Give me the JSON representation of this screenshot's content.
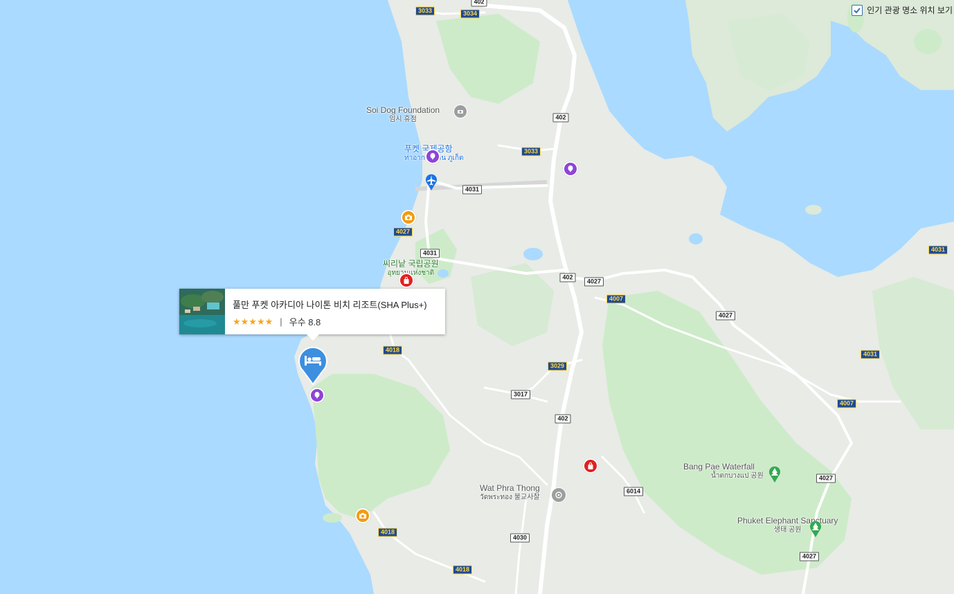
{
  "controls": {
    "popular_places_toggle": {
      "label": "인기 관광 명소 위치 보기",
      "checked": true
    }
  },
  "colors": {
    "water": "#aadaff",
    "land": "#e8ebe6",
    "park": "#cdebc9",
    "road": "#ffffff",
    "accent_blue": "#4a90e2",
    "poi_purple": "#8e44d6",
    "poi_orange": "#f29c11",
    "poi_red": "#e02121"
  },
  "places": [
    {
      "name": "Soi Dog Foundation",
      "sub": "임시 휴점",
      "style": "gray",
      "icon": "camera-icon"
    },
    {
      "name": "푸켓 국제공항",
      "sub": "ท่าอากาศยาน ภูเก็ต",
      "style": "blue",
      "icon": "airport-icon"
    },
    {
      "name": "씨리낱 국립공원",
      "sub": "อุทยานแห่งชาติ",
      "style": "green",
      "icon": ""
    },
    {
      "name": "Wat Phra Thong",
      "sub": "วัดพระทอง 불교사찰",
      "style": "gray",
      "icon": "temple-icon"
    },
    {
      "name": "Bang Pae Waterfall",
      "sub": "น้ำตกบางแป 공원",
      "style": "gray",
      "icon": "park-icon"
    },
    {
      "name": "Phuket Elephant Sanctuary",
      "sub": "생태 공원",
      "style": "gray",
      "icon": "park-icon"
    }
  ],
  "road_shields": [
    {
      "label": "402",
      "style": "white"
    },
    {
      "label": "3033",
      "style": "yellow"
    },
    {
      "label": "3034",
      "style": "yellow"
    },
    {
      "label": "402",
      "style": "white"
    },
    {
      "label": "3033",
      "style": "yellow"
    },
    {
      "label": "4031",
      "style": "white"
    },
    {
      "label": "4027",
      "style": "yellow"
    },
    {
      "label": "4031",
      "style": "white"
    },
    {
      "label": "402",
      "style": "white"
    },
    {
      "label": "4027",
      "style": "white"
    },
    {
      "label": "4007",
      "style": "yellow"
    },
    {
      "label": "4027",
      "style": "white"
    },
    {
      "label": "4031",
      "style": "yellow"
    },
    {
      "label": "4031",
      "style": "yellow"
    },
    {
      "label": "4018",
      "style": "yellow"
    },
    {
      "label": "3029",
      "style": "yellow"
    },
    {
      "label": "3017",
      "style": "white"
    },
    {
      "label": "402",
      "style": "white"
    },
    {
      "label": "4007",
      "style": "yellow"
    },
    {
      "label": "6014",
      "style": "white"
    },
    {
      "label": "4027",
      "style": "white"
    },
    {
      "label": "4018",
      "style": "yellow"
    },
    {
      "label": "4030",
      "style": "white"
    },
    {
      "label": "4018",
      "style": "yellow"
    },
    {
      "label": "4027",
      "style": "white"
    }
  ],
  "poi_markers": [
    {
      "kind": "attraction",
      "color": "#8e44d6",
      "icon": "balloon-icon"
    },
    {
      "kind": "attraction",
      "color": "#8e44d6",
      "icon": "balloon-icon"
    },
    {
      "kind": "attraction",
      "color": "#8e44d6",
      "icon": "balloon-icon"
    },
    {
      "kind": "photo-spot",
      "color": "#f29c11",
      "icon": "camera-icon"
    },
    {
      "kind": "photo-spot",
      "color": "#f29c11",
      "icon": "camera-icon"
    },
    {
      "kind": "shopping",
      "color": "#e02121",
      "icon": "shopping-bag-icon"
    },
    {
      "kind": "shopping",
      "color": "#e02121",
      "icon": "shopping-bag-icon"
    }
  ],
  "hotel": {
    "name": "풀만 푸켓 아카디아 나이톤 비치 리조트(SHA Plus+)",
    "stars": "★★★★★",
    "rating_label": "우수",
    "rating_value": "8.8",
    "separator": "|",
    "pin_icon": "bed-icon"
  }
}
